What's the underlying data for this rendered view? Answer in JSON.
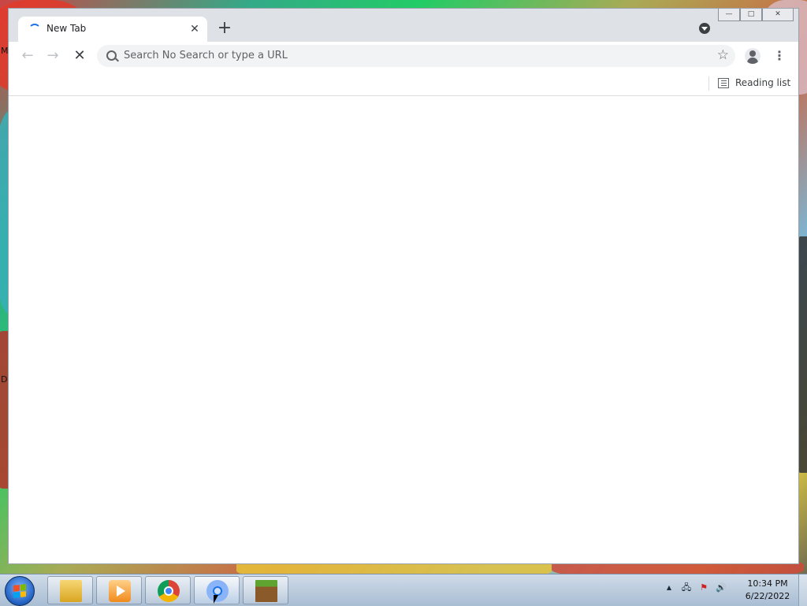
{
  "desktop": {
    "edge_text_top": "M",
    "edge_text_bottom": "D"
  },
  "browser": {
    "tab": {
      "title": "New Tab",
      "close_icon": "close-icon"
    },
    "new_tab_symbol": "+",
    "caption": {
      "minimize": "—",
      "maximize": "□",
      "close": "✕"
    },
    "toolbar": {
      "back": "←",
      "forward": "→",
      "stop": "✕",
      "omnibox_text": "Search No Search or type a URL",
      "star": "☆",
      "menu": "⋮"
    },
    "bookmarks_bar": {
      "reading_list_label": "Reading list"
    }
  },
  "taskbar": {
    "items": [
      "Windows Explorer",
      "Windows Media Player",
      "Google Chrome",
      "Google Chrome (loading)",
      "Minecraft"
    ],
    "tray": {
      "up_arrow": "▲",
      "network": "🖧",
      "flag": "⚑",
      "volume": "🔊"
    },
    "clock": {
      "time": "10:34 PM",
      "date": "6/22/2022"
    }
  },
  "colors": {
    "accent": "#1a73e8",
    "tabstrip": "#dee1e6",
    "omnibox": "#f1f3f4"
  }
}
